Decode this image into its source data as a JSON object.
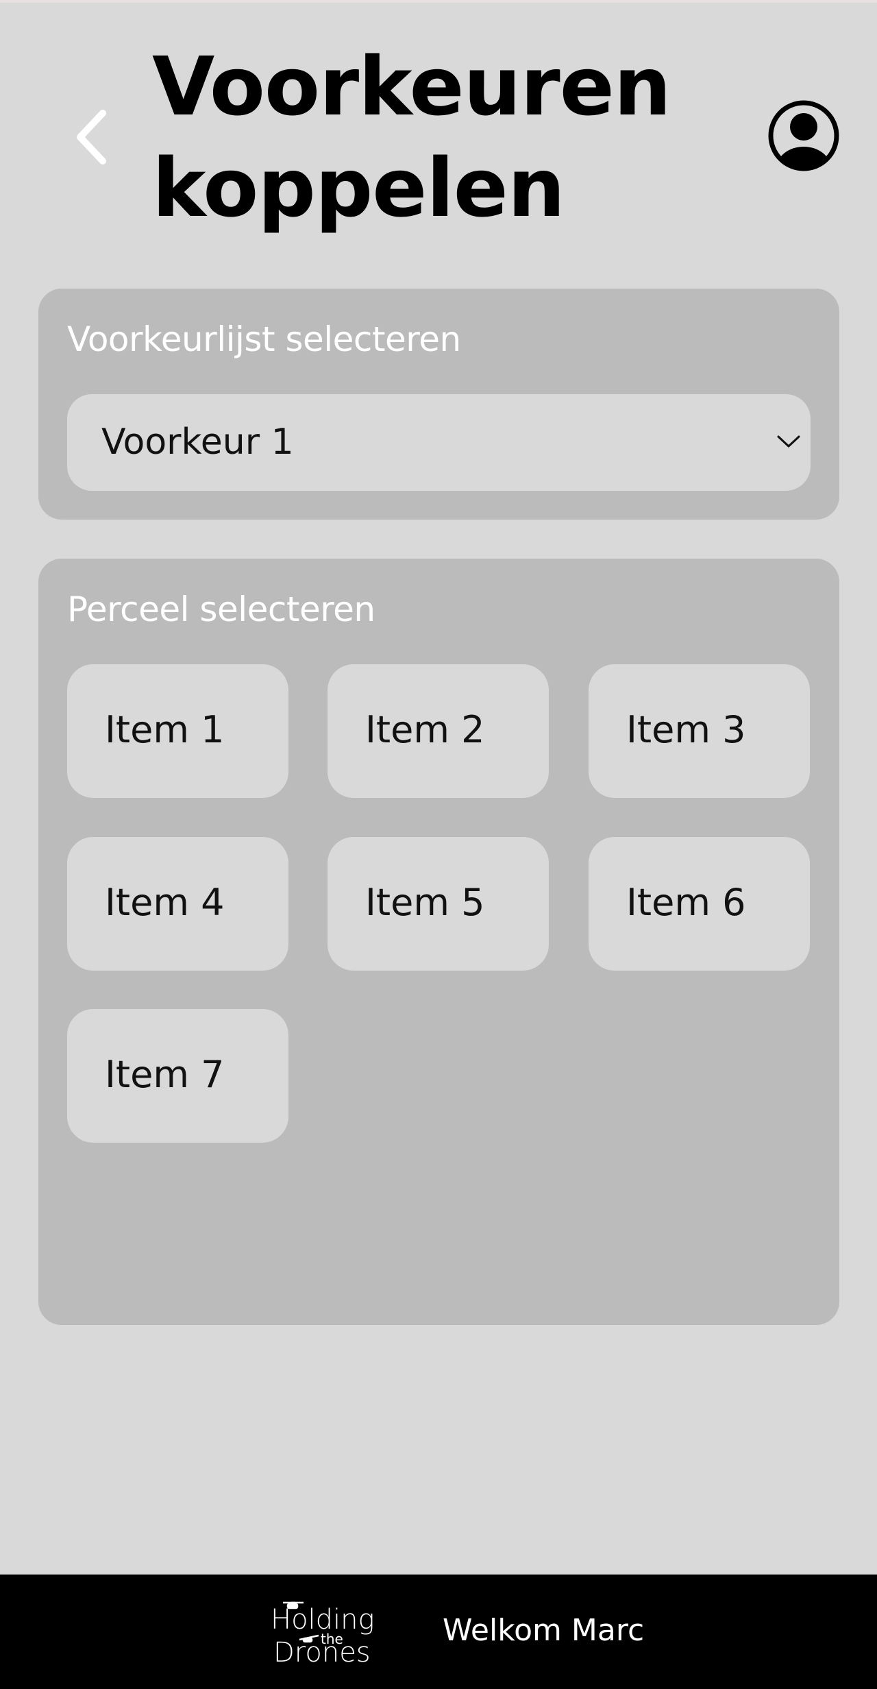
{
  "header": {
    "title": "Voorkeuren koppelen",
    "back_icon": "chevron-left-icon",
    "profile_icon": "user-circle-icon"
  },
  "preference_card": {
    "label": "Voorkeurlijst selecteren",
    "dropdown": {
      "selected": "Voorkeur 1",
      "icon": "chevron-down-icon"
    }
  },
  "parcel_card": {
    "label": "Perceel selecteren",
    "items": [
      {
        "label": "Item 1"
      },
      {
        "label": "Item 2"
      },
      {
        "label": "Item 3"
      },
      {
        "label": "Item 4"
      },
      {
        "label": "Item 5"
      },
      {
        "label": "Item 6"
      },
      {
        "label": "Item 7"
      }
    ]
  },
  "footer": {
    "logo_text": "Holding the Drones",
    "welcome": "Welkom Marc"
  },
  "colors": {
    "background": "#d9d9d9",
    "card": "#bbbbbb",
    "footer": "#000000",
    "card_label": "#ffffff"
  }
}
